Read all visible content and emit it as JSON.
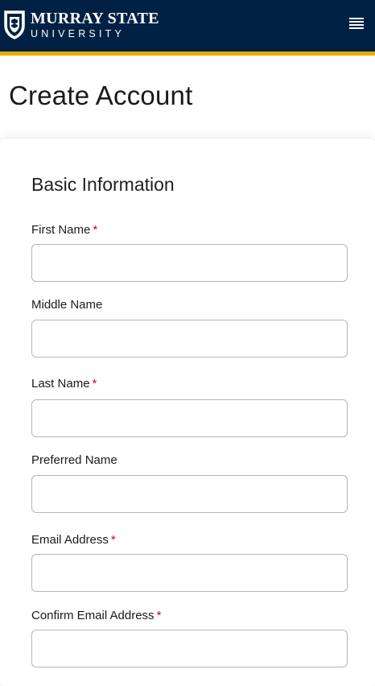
{
  "header": {
    "logo_line1": "MURRAY STATE",
    "logo_line2": "UNIVERSITY",
    "brand_color": "#002144",
    "accent_color": "#ecac00",
    "menu_icon": "hamburger-menu-icon"
  },
  "page": {
    "title": "Create Account"
  },
  "form": {
    "section_title": "Basic Information",
    "required_marker": "*",
    "required_color": "#d0021b",
    "fields": [
      {
        "label": "First Name",
        "required": true,
        "value": "",
        "placeholder": ""
      },
      {
        "label": "Middle Name",
        "required": false,
        "value": "",
        "placeholder": ""
      },
      {
        "label": "Last Name",
        "required": true,
        "value": "",
        "placeholder": ""
      },
      {
        "label": "Preferred Name",
        "required": false,
        "value": "",
        "placeholder": ""
      },
      {
        "label": "Email Address",
        "required": true,
        "value": "",
        "placeholder": ""
      },
      {
        "label": "Confirm Email Address",
        "required": true,
        "value": "",
        "placeholder": ""
      }
    ]
  }
}
